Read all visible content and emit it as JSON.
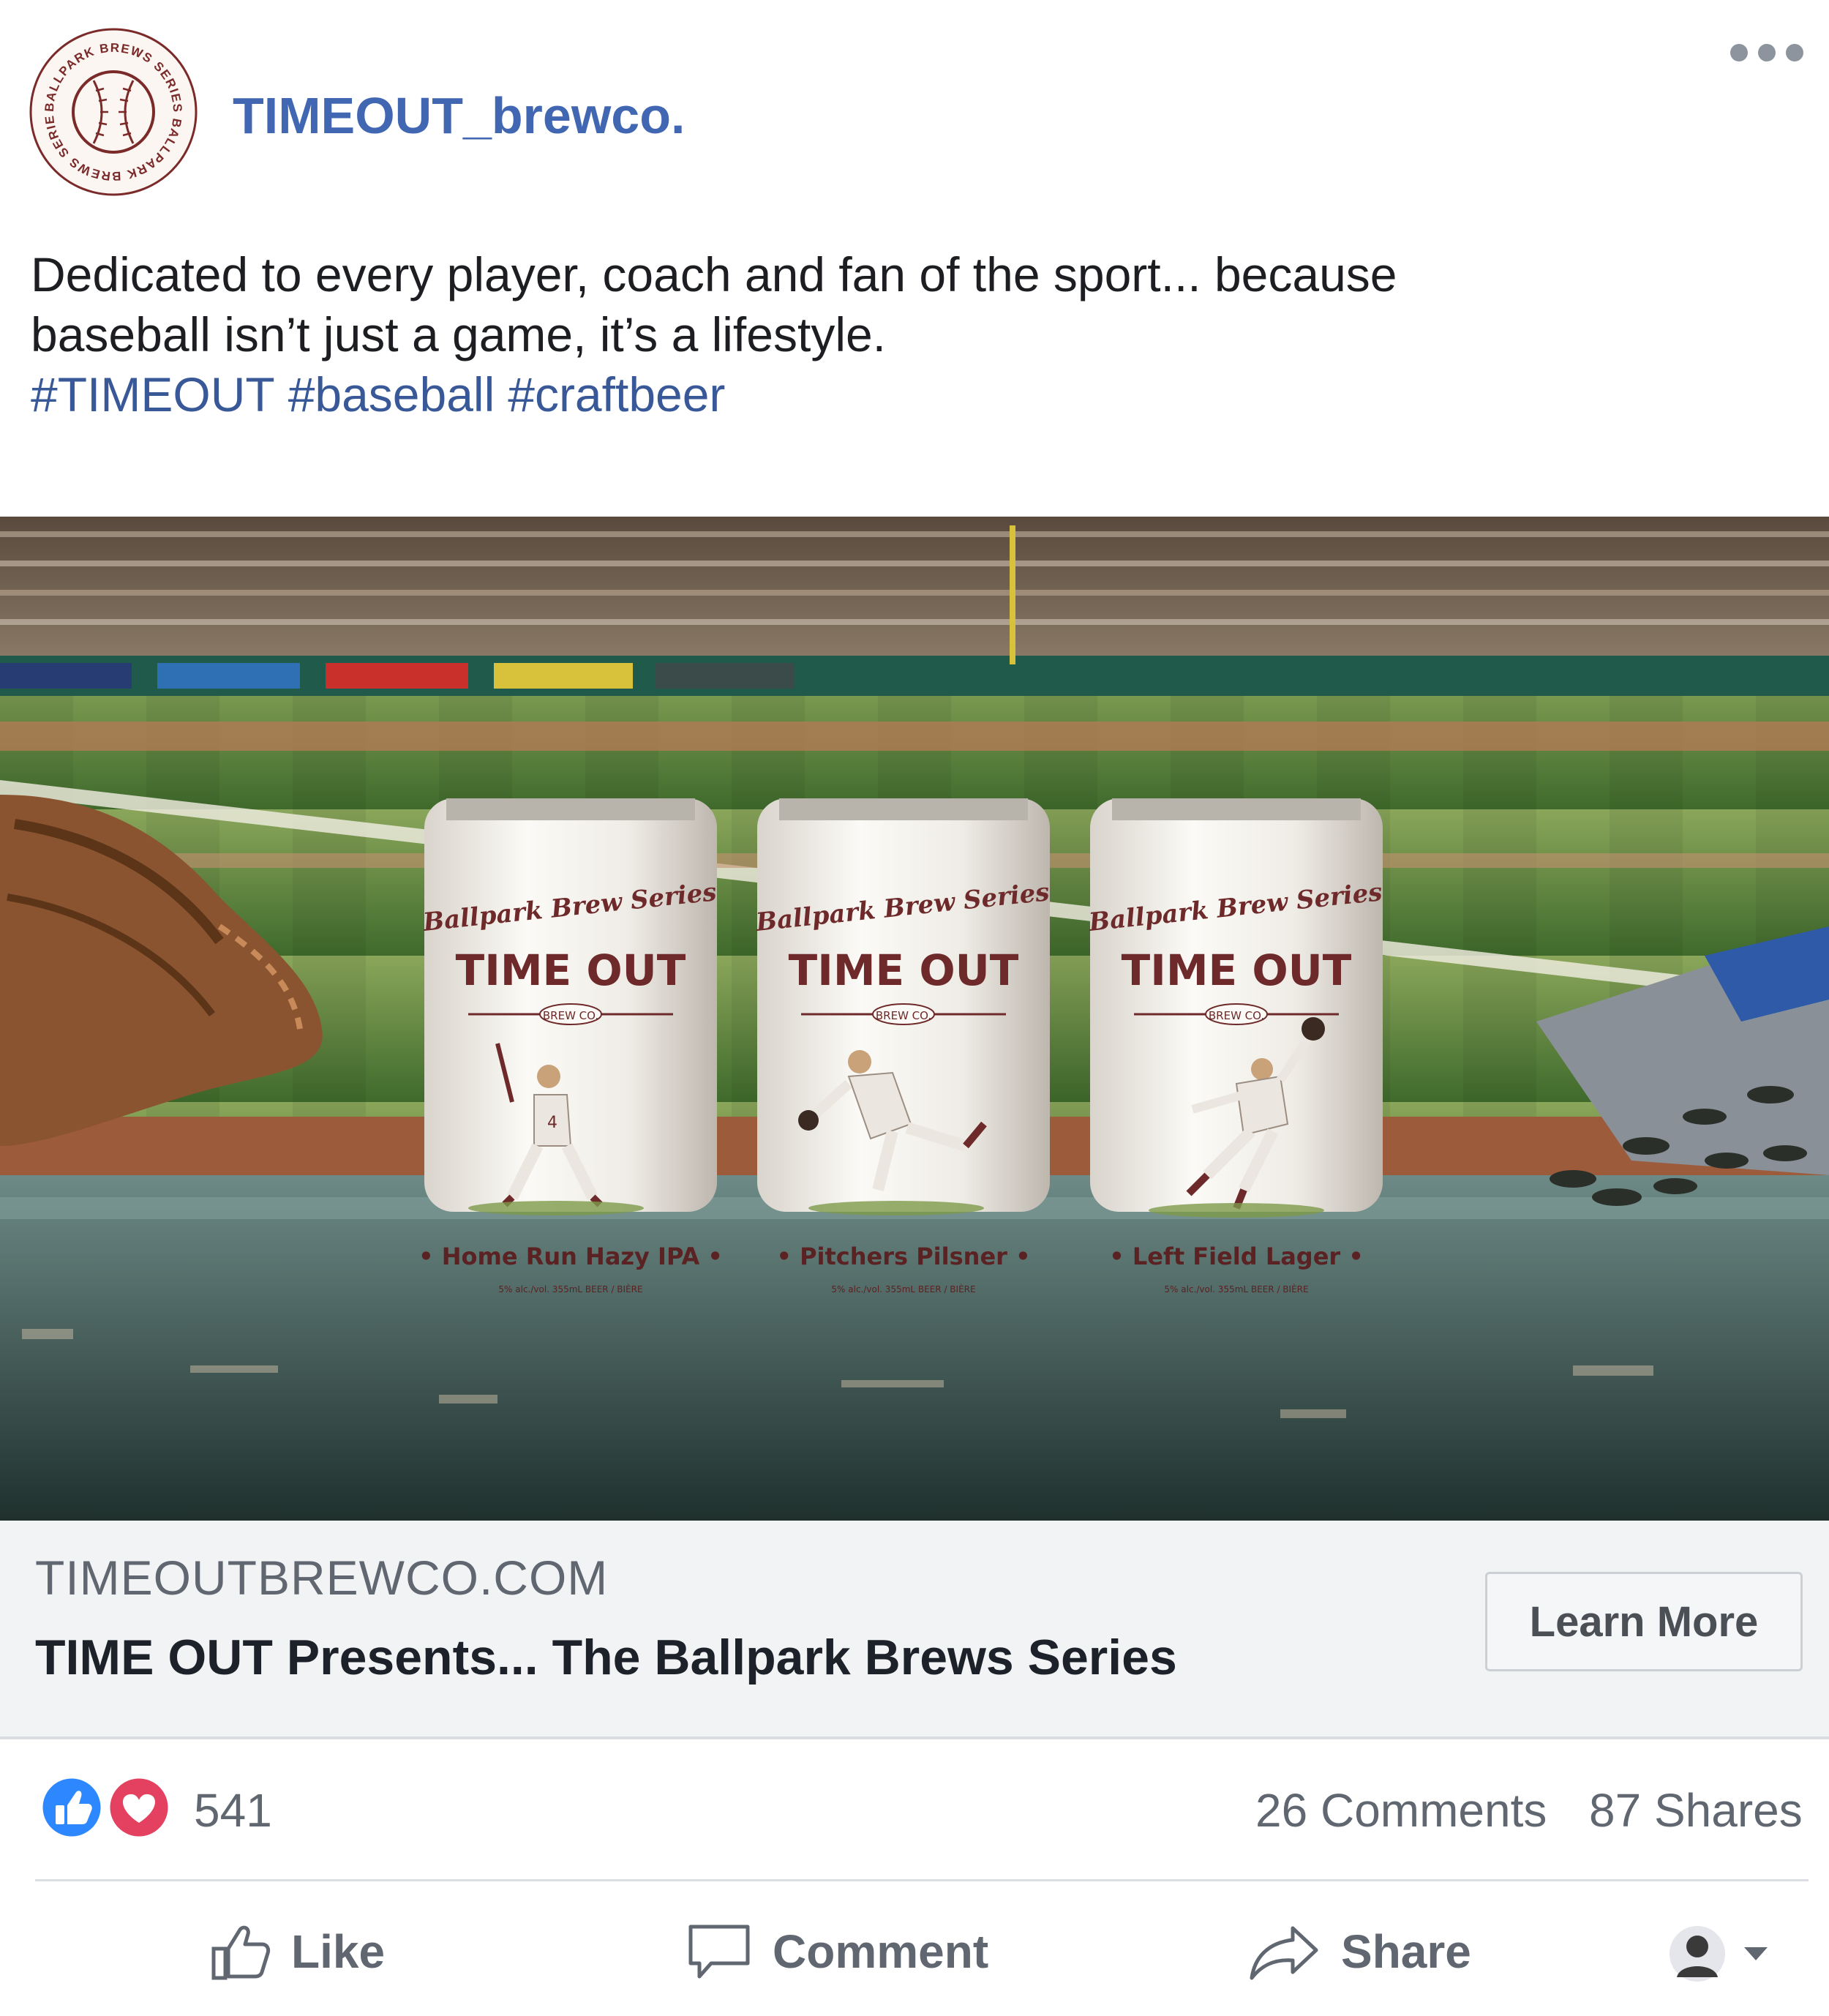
{
  "page": {
    "name": "TIMEOUT_brewco.",
    "logo_ring_text": "BALLPARK BREWS SERIES BALLPARK BREWS SERIES"
  },
  "caption": {
    "line1": "Dedicated to every player, coach and fan of the sport... because",
    "line2": "baseball isn’t just a game, it’s a lifestyle.",
    "hashtags": [
      "#TIMEOUT",
      "#baseball",
      "#craftbeer"
    ]
  },
  "image": {
    "description_icon": "beer-cans-baseball-photo",
    "cans": [
      {
        "series": "Ballpark Brew Series",
        "brand": "TIME OUT",
        "sub": "BREW CO.",
        "name": "• Home Run Hazy IPA •",
        "fine": "5% alc./vol. 355mL BEER / BIÈRE"
      },
      {
        "series": "Ballpark Brew Series",
        "brand": "TIME OUT",
        "sub": "BREW CO.",
        "name": "• Pitchers Pilsner •",
        "fine": "5% alc./vol. 355mL BEER / BIÈRE"
      },
      {
        "series": "Ballpark Brew Series",
        "brand": "TIME OUT",
        "sub": "BREW CO.",
        "name": "• Left Field Lager •",
        "fine": "5% alc./vol. 355mL BEER / BIÈRE"
      }
    ],
    "jersey_number": "4"
  },
  "link_preview": {
    "domain": "TIMEOUTBREWCO.COM",
    "title": "TIME OUT Presents... The Ballpark Brews Series",
    "cta_label": "Learn More"
  },
  "stats": {
    "reaction_count": "541",
    "comments": "26 Comments",
    "shares": "87 Shares"
  },
  "actions": {
    "like": "Like",
    "comment": "Comment",
    "share": "Share"
  },
  "colors": {
    "brand_link": "#4267b2",
    "hashtag": "#385898",
    "like_blue": "#2d88ff",
    "love_red": "#e4405f",
    "can_maroon": "#6e2a2a"
  }
}
